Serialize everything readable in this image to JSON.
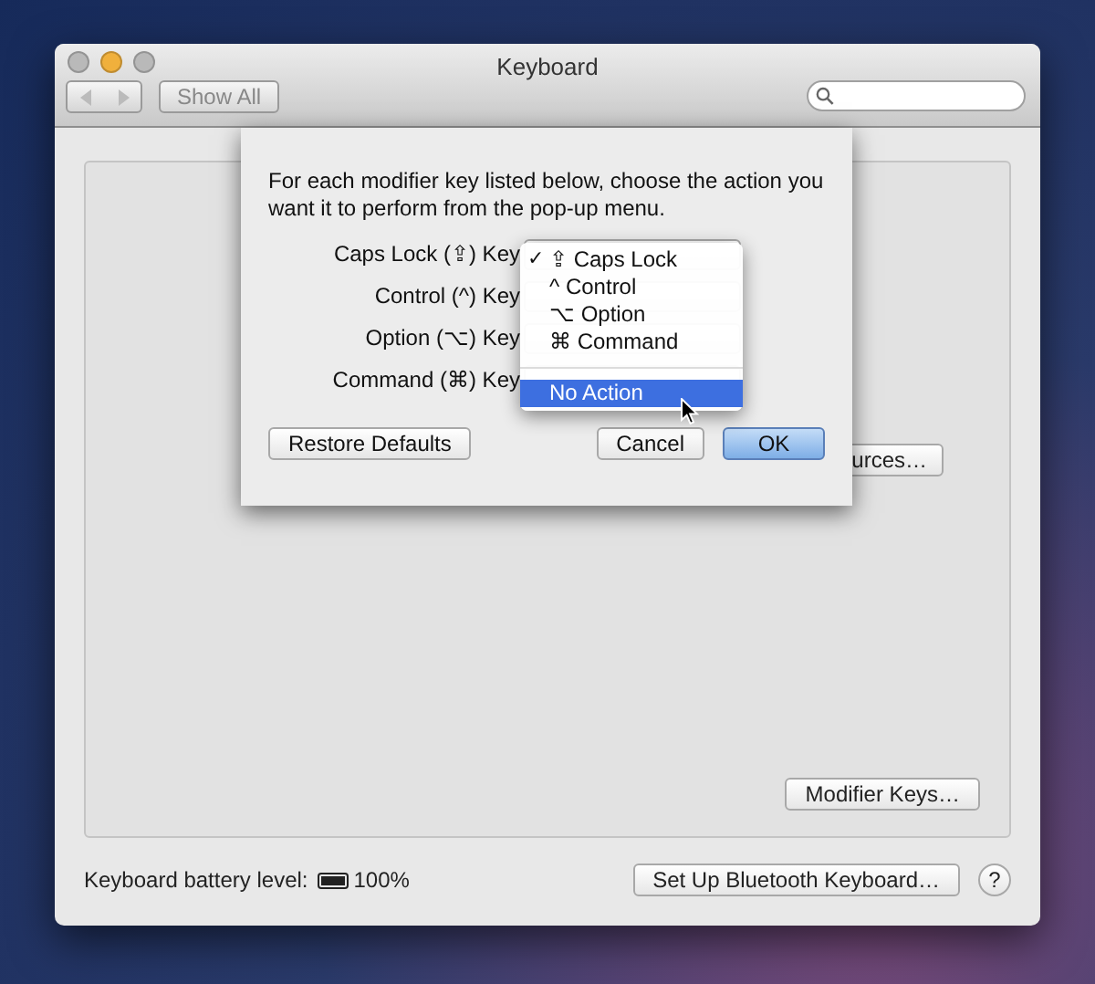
{
  "window": {
    "title": "Keyboard",
    "traffic_lights": [
      {
        "color": "#b9b9b9"
      },
      {
        "color": "#f0b03c"
      },
      {
        "color": "#b9b9b9"
      }
    ]
  },
  "toolbar": {
    "show_all": "Show All"
  },
  "panel": {
    "input_sources_button": "urces…",
    "modifier_keys_button": "Modifier Keys…"
  },
  "footer": {
    "battery_label": "Keyboard battery level:",
    "battery_reading": "100%",
    "bluetooth_button": "Set Up Bluetooth Keyboard…",
    "help": "?"
  },
  "sheet": {
    "instructions": "For each modifier key listed below, choose the action you want it to perform from the pop-up menu.",
    "rows": [
      {
        "label": "Caps Lock (⇪) Key"
      },
      {
        "label": "Control (^) Key"
      },
      {
        "label": "Option (⌥) Key"
      },
      {
        "label": "Command (⌘) Key"
      }
    ],
    "menu": [
      {
        "kind": "item",
        "label": "⇪ Caps Lock",
        "checked": true,
        "selected": false
      },
      {
        "kind": "item",
        "label": "^ Control",
        "checked": false,
        "selected": false
      },
      {
        "kind": "item",
        "label": "⌥ Option",
        "checked": false,
        "selected": false
      },
      {
        "kind": "item",
        "label": "⌘ Command",
        "checked": false,
        "selected": false
      },
      {
        "kind": "separator"
      },
      {
        "kind": "item",
        "label": "No Action",
        "checked": false,
        "selected": true
      }
    ],
    "check_mark": "✓",
    "buttons": [
      {
        "label": "Restore Defaults",
        "default": false
      },
      {
        "label": "Cancel",
        "default": false
      },
      {
        "label": "OK",
        "default": true
      }
    ]
  }
}
